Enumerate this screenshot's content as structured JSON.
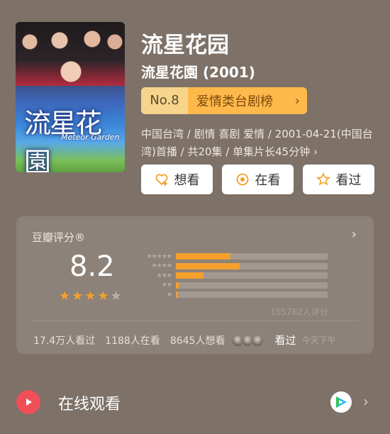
{
  "header": {
    "poster_title": "流星花園",
    "poster_subtitle": "Meteor Garden",
    "title": "流星花园",
    "subtitle": "流星花園 (2001)",
    "rank_no": "No.8",
    "rank_label": "爱情类台剧榜",
    "meta": "中国台湾 / 剧情 喜剧 爱情 / 2001-04-21(中国台湾)首播 / 共20集 / 单集片长45分钟 ›"
  },
  "actions": [
    {
      "label": "想看",
      "icon": "heart-plus-icon"
    },
    {
      "label": "在看",
      "icon": "target-icon"
    },
    {
      "label": "看过",
      "icon": "star-outline-icon"
    }
  ],
  "rating": {
    "title": "豆瓣评分®",
    "score": "8.2",
    "stars_filled": 4,
    "stars_total": 5,
    "distribution": [
      {
        "stars": "★★★★★",
        "fraction": 0.36
      },
      {
        "stars": "★★★★",
        "fraction": 0.42
      },
      {
        "stars": "★★★",
        "fraction": 0.18
      },
      {
        "stars": "★★",
        "fraction": 0.02
      },
      {
        "stars": "★",
        "fraction": 0.01
      }
    ],
    "votes": "105762人评分",
    "watched": "17.4万人看过",
    "watching": "1188人在看",
    "want": "8645人想看",
    "friends_seen": "看过",
    "when": "今天下午"
  },
  "colors": {
    "accent": "#f3a02d",
    "star": "#f3a02d",
    "star_empty": "#b8afa6"
  },
  "watch": {
    "label": "在线观看"
  }
}
